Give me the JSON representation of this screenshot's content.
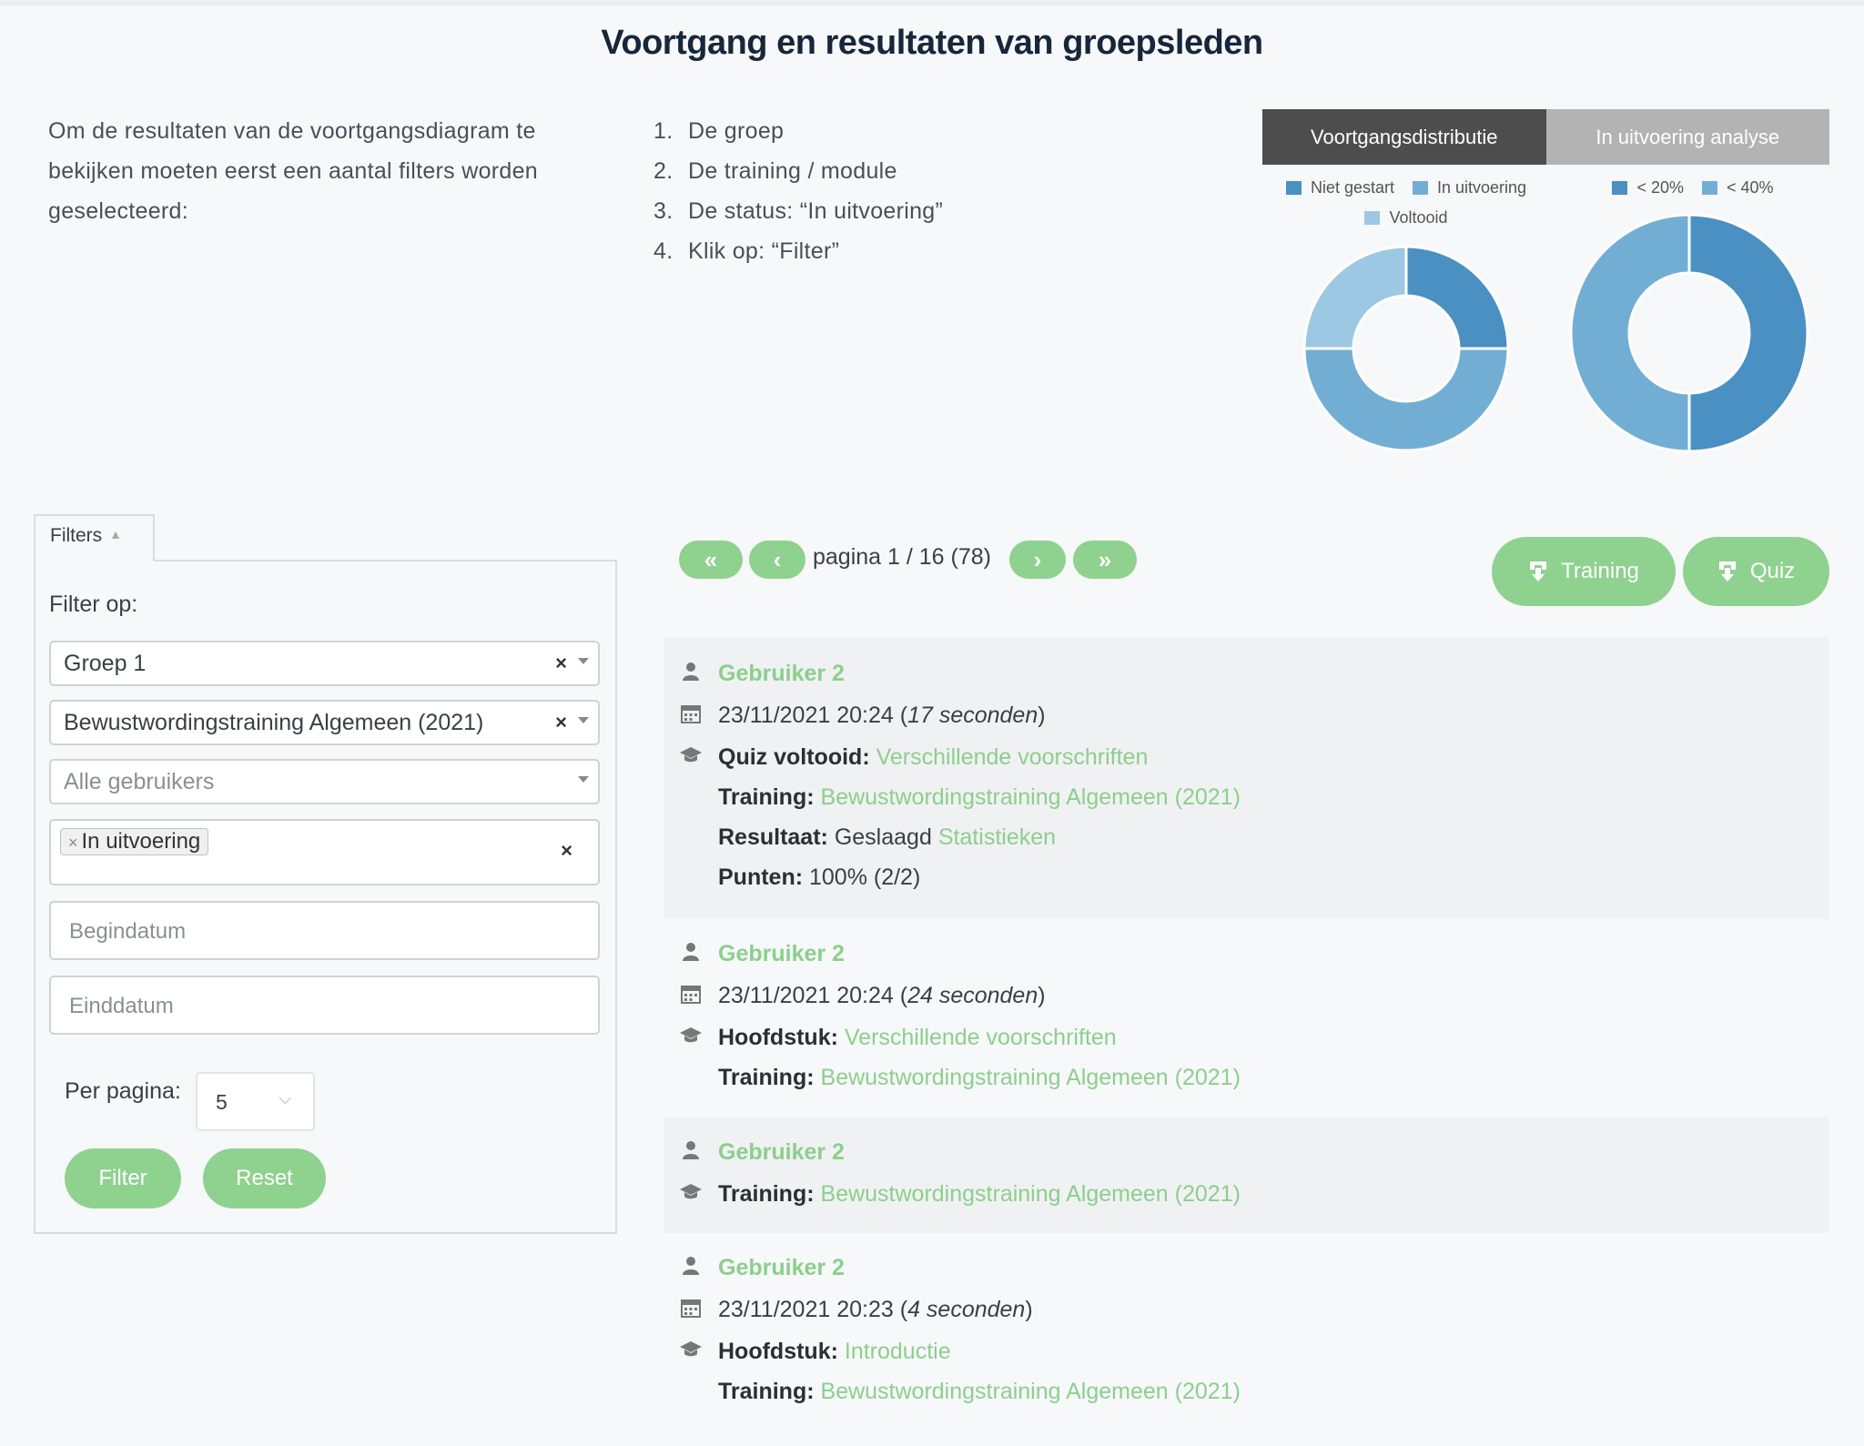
{
  "page": {
    "title": "Voortgang en resultaten van groepsleden",
    "intro": "Om de resultaten van de voortgangsdiagram te bekijken moeten eerst een aantal filters worden geselecteerd:",
    "steps": [
      {
        "num": "1.",
        "text": "De groep"
      },
      {
        "num": "2.",
        "text": "De training / module"
      },
      {
        "num": "3.",
        "text": "De status: “In uitvoering”"
      },
      {
        "num": "4.",
        "text": "Klik op: “Filter”"
      }
    ]
  },
  "charts": {
    "tabs": [
      {
        "label": "Voortgangsdistributie",
        "active": true
      },
      {
        "label": "In uitvoering analyse",
        "active": false
      }
    ],
    "legend1": [
      {
        "label": "Niet gestart",
        "color": "#4a90c2"
      },
      {
        "label": "In uitvoering",
        "color": "#72aed4"
      },
      {
        "label": "Voltooid",
        "color": "#9cc8e3"
      }
    ],
    "legend2": [
      {
        "label": "< 20%",
        "color": "#4a90c2"
      },
      {
        "label": "< 40%",
        "color": "#72aed4"
      }
    ]
  },
  "chart_data": [
    {
      "type": "pie",
      "labels": [
        "Niet gestart",
        "In uitvoering",
        "Voltooid"
      ],
      "values": [
        25,
        50,
        25
      ],
      "colors": [
        "#4a90c2",
        "#72aed4",
        "#9cc8e3"
      ],
      "legend": "top"
    },
    {
      "type": "pie",
      "labels": [
        "< 20%",
        "< 40%"
      ],
      "values": [
        50,
        50
      ],
      "colors": [
        "#4a90c2",
        "#72aed4"
      ],
      "legend": "top"
    }
  ],
  "filters": {
    "tab_label": "Filters",
    "filter_by": "Filter op:",
    "group": "Groep 1",
    "training": "Bewustwordingstraining Algemeen (2021)",
    "users_placeholder": "Alle gebruikers",
    "status_tag": "In uitvoering",
    "start_date_placeholder": "Begindatum",
    "end_date_placeholder": "Einddatum",
    "per_page_label": "Per pagina:",
    "per_page_value": "5",
    "filter_button": "Filter",
    "reset_button": "Reset"
  },
  "pagination": {
    "first": "«",
    "prev": "‹",
    "text": "pagina 1 / 16 (78)",
    "next": "›",
    "last": "»"
  },
  "downloads": {
    "training": "Training",
    "quiz": "Quiz"
  },
  "entries": [
    {
      "user": "Gebruiker 2",
      "date": "23/11/2021 20:24",
      "duration": "17 seconden",
      "type_label": "Quiz voltooid:",
      "type_value": "Verschillende voorschriften",
      "training_label": "Training:",
      "training_value": "Bewustwordingstraining Algemeen (2021)",
      "result_label": "Resultaat:",
      "result_value": "Geslaagd",
      "stats_link": "Statistieken",
      "points_label": "Punten:",
      "points_value": "100% (2/2)"
    },
    {
      "user": "Gebruiker 2",
      "date": "23/11/2021 20:24",
      "duration": "24 seconden",
      "type_label": "Hoofdstuk:",
      "type_value": "Verschillende voorschriften",
      "training_label": "Training:",
      "training_value": "Bewustwordingstraining Algemeen (2021)"
    },
    {
      "user": "Gebruiker 2",
      "training_label": "Training:",
      "training_value": "Bewustwordingstraining Algemeen (2021)"
    },
    {
      "user": "Gebruiker 2",
      "date": "23/11/2021 20:23",
      "duration": "4 seconden",
      "type_label": "Hoofdstuk:",
      "type_value": "Introductie",
      "training_label": "Training:",
      "training_value": "Bewustwordingstraining Algemeen (2021)"
    }
  ]
}
